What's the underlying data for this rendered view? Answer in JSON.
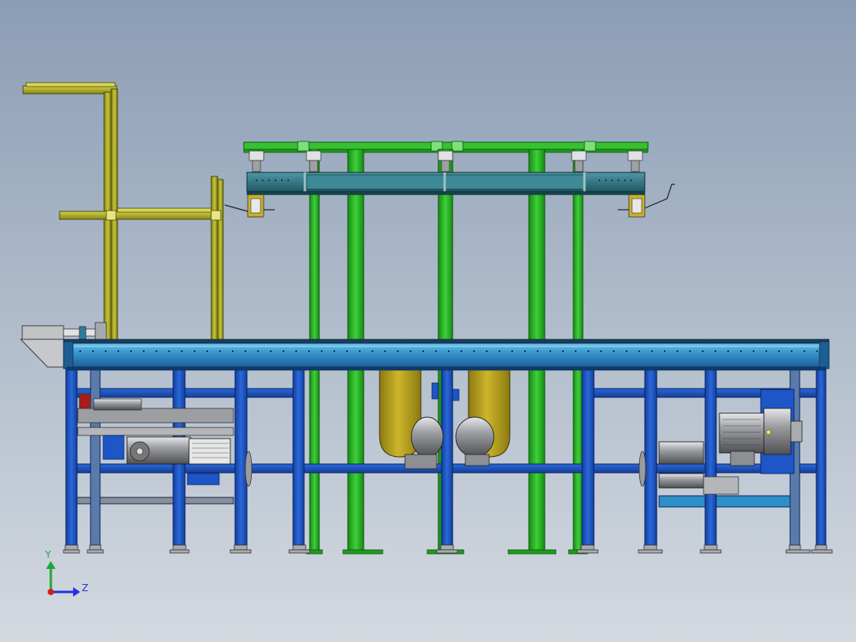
{
  "triad": {
    "y_label": "Y",
    "z_label": "Z",
    "y_color": "#1fa83a",
    "z_color": "#2233dd",
    "x_color": "#d02020"
  },
  "colors": {
    "frame_blue": "#1e56c8",
    "frame_blue_dark": "#0e2f86",
    "conveyor_teal": "#2f8fc8",
    "conveyor_top": "#5ab4e2",
    "gantry_green": "#2fbf2a",
    "gantry_green_dark": "#137a12",
    "beam_teal": "#2e6f7a",
    "yellow_frame": "#b7b52a",
    "yellow_frame_dark": "#6f6e12",
    "hopper_yellow": "#b8a21e",
    "motor_grey": "#8d8f93",
    "motor_light": "#c8cacd"
  }
}
